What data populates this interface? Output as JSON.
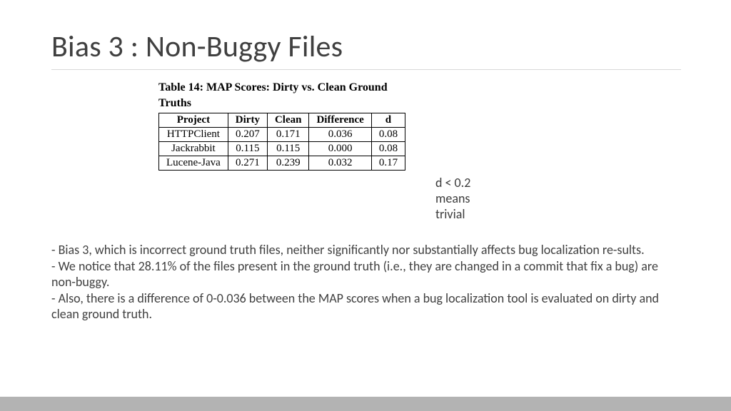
{
  "title": "Bias 3 : Non-Buggy Files",
  "table": {
    "caption_line1": "Table 14:  MAP Scores:  Dirty vs.  Clean Ground",
    "caption_line2": "Truths",
    "headers": [
      "Project",
      "Dirty",
      "Clean",
      "Difference",
      "d"
    ],
    "rows": [
      [
        "HTTPClient",
        "0.207",
        "0.171",
        "0.036",
        "0.08"
      ],
      [
        "Jackrabbit",
        "0.115",
        "0.115",
        "0.000",
        "0.08"
      ],
      [
        "Lucene-Java",
        "0.271",
        "0.239",
        "0.032",
        "0.17"
      ]
    ]
  },
  "note": "d < 0.2 means trivial",
  "body": {
    "p1": "- Bias 3, which is incorrect ground truth files, neither significantly nor substantially affects bug localization re-sults.",
    "p2": "- We notice that 28.11% of the files present in the ground truth (i.e., they are changed in a commit that fix a bug) are non-buggy.",
    "p3": "- Also, there is a difference of 0-0.036 between the MAP scores when a bug localization tool is evaluated on dirty and clean ground truth."
  },
  "chart_data": {
    "type": "table",
    "title": "Table 14: MAP Scores: Dirty vs. Clean Ground Truths",
    "columns": [
      "Project",
      "Dirty",
      "Clean",
      "Difference",
      "d"
    ],
    "rows": [
      {
        "Project": "HTTPClient",
        "Dirty": 0.207,
        "Clean": 0.171,
        "Difference": 0.036,
        "d": 0.08
      },
      {
        "Project": "Jackrabbit",
        "Dirty": 0.115,
        "Clean": 0.115,
        "Difference": 0.0,
        "d": 0.08
      },
      {
        "Project": "Lucene-Java",
        "Dirty": 0.271,
        "Clean": 0.239,
        "Difference": 0.032,
        "d": 0.17
      }
    ]
  }
}
